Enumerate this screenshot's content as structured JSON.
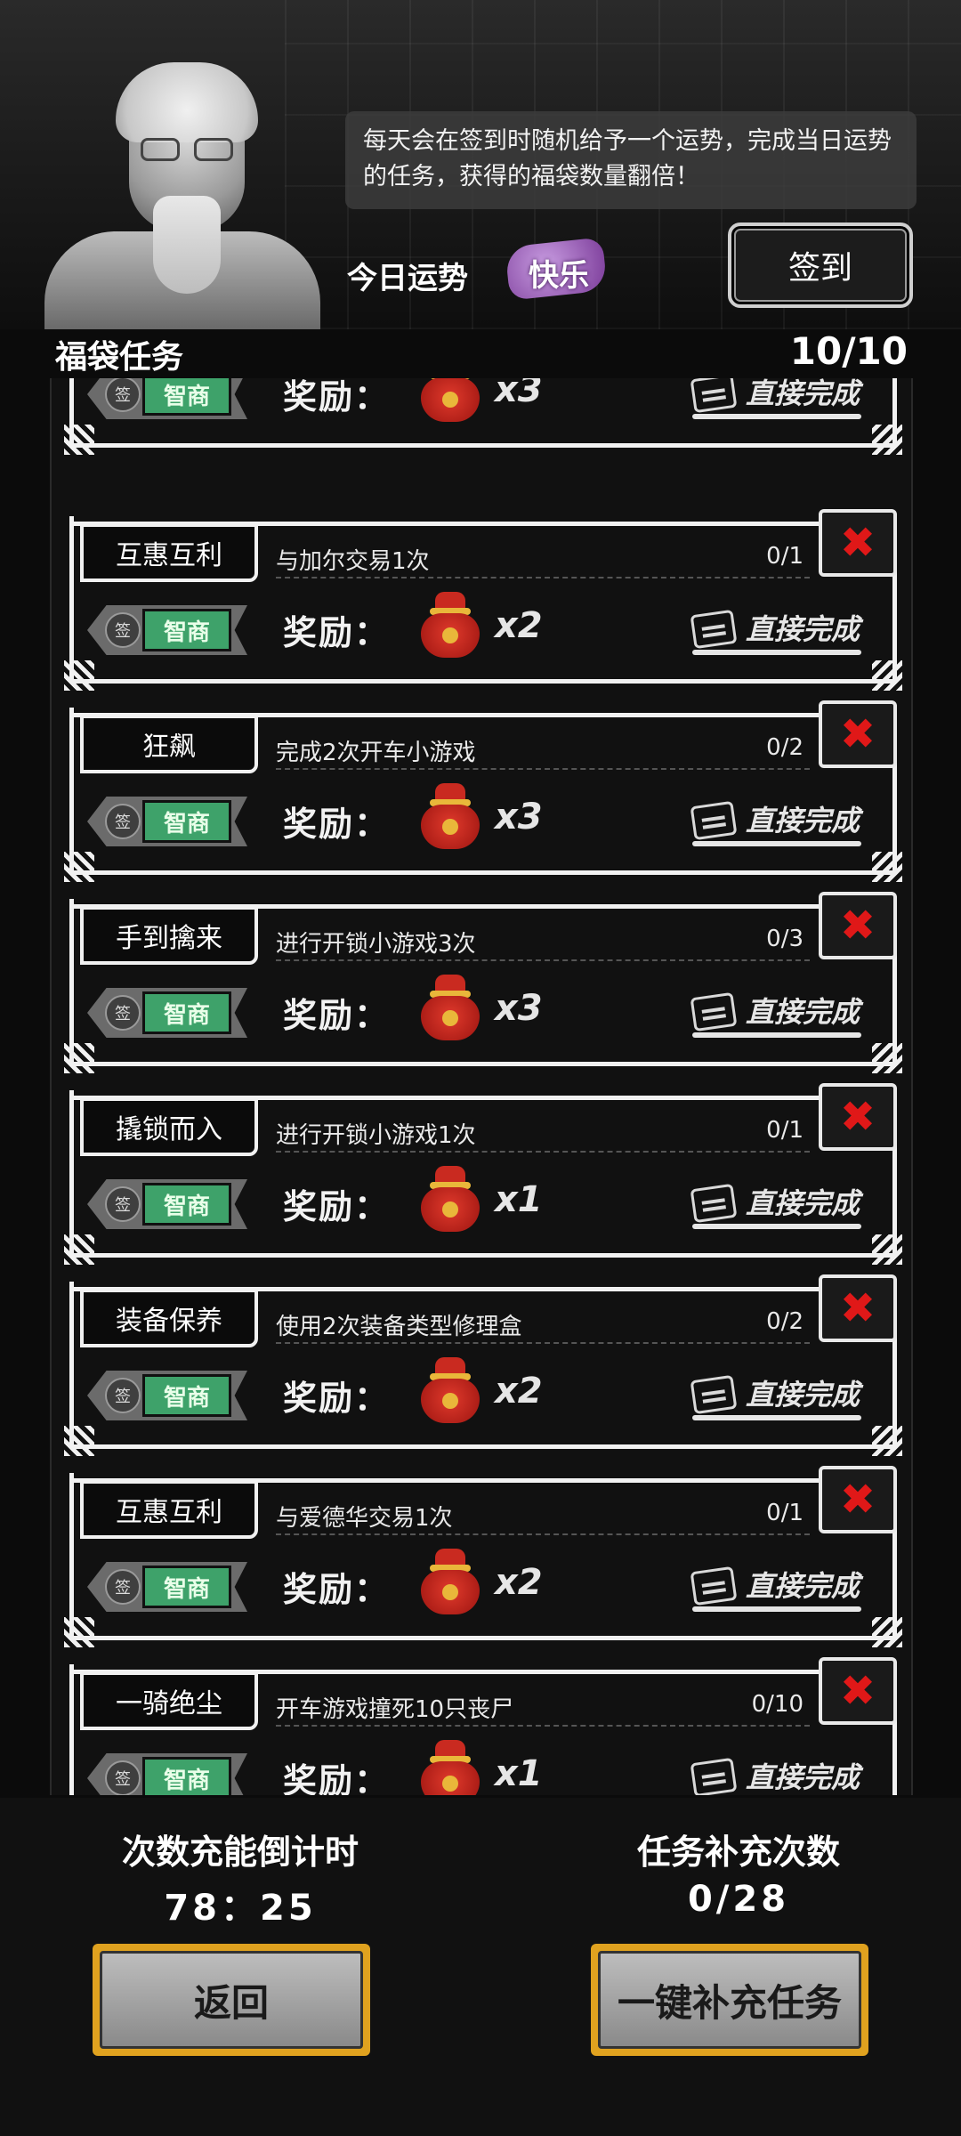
{
  "header": {
    "intro": "每天会在签到时随机给予一个运势，完成当日运势的任务，获得的福袋数量翻倍！",
    "fortune_label": "今日运势",
    "fortune_value": "快乐",
    "signin_label": "签到"
  },
  "section": {
    "title": "福袋任务",
    "count": "10/10"
  },
  "reward_label": "奖励：",
  "badge_seal": "签",
  "badge_plate": "智商",
  "complete_label": "直接完成",
  "tasks": [
    {
      "name": "",
      "desc": "",
      "progress": "",
      "mult": "x3"
    },
    {
      "name": "互惠互利",
      "desc": "与加尔交易1次",
      "progress": "0/1",
      "mult": "x2"
    },
    {
      "name": "狂飙",
      "desc": "完成2次开车小游戏",
      "progress": "0/2",
      "mult": "x3"
    },
    {
      "name": "手到擒来",
      "desc": "进行开锁小游戏3次",
      "progress": "0/3",
      "mult": "x3"
    },
    {
      "name": "撬锁而入",
      "desc": "进行开锁小游戏1次",
      "progress": "0/1",
      "mult": "x1"
    },
    {
      "name": "装备保养",
      "desc": "使用2次装备类型修理盒",
      "progress": "0/2",
      "mult": "x2"
    },
    {
      "name": "互惠互利",
      "desc": "与爱德华交易1次",
      "progress": "0/1",
      "mult": "x2"
    },
    {
      "name": "一骑绝尘",
      "desc": "开车游戏撞死10只丧尸",
      "progress": "0/10",
      "mult": "x1"
    }
  ],
  "bottom": {
    "recharge_title": "次数充能倒计时",
    "recharge_value": "78：25",
    "refill_title": "任务补充次数",
    "refill_value": "0/28",
    "back_label": "返回",
    "refill_button_label": "一键补充任务"
  }
}
